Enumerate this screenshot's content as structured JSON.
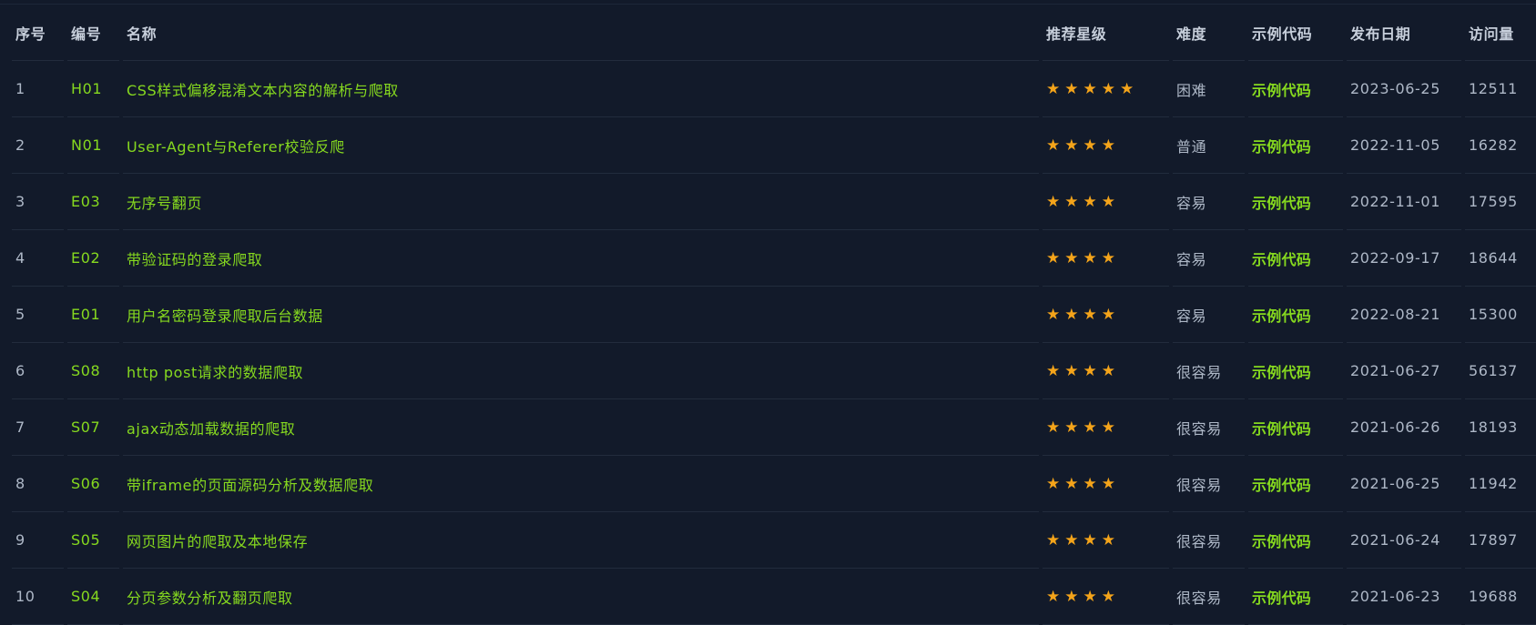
{
  "table": {
    "headers": {
      "index": "序号",
      "code": "编号",
      "name": "名称",
      "stars": "推荐星级",
      "difficulty": "难度",
      "example": "示例代码",
      "date": "发布日期",
      "views": "访问量"
    },
    "rows": [
      {
        "index": "1",
        "code": "H01",
        "name": "CSS样式偏移混淆文本内容的解析与爬取",
        "stars": "★★★★★",
        "star_count": 5,
        "difficulty": "困难",
        "example": "示例代码",
        "date": "2023-06-25",
        "views": "12511"
      },
      {
        "index": "2",
        "code": "N01",
        "name": "User-Agent与Referer校验反爬",
        "stars": "★★★★",
        "star_count": 4,
        "difficulty": "普通",
        "example": "示例代码",
        "date": "2022-11-05",
        "views": "16282"
      },
      {
        "index": "3",
        "code": "E03",
        "name": "无序号翻页",
        "stars": "★★★★",
        "star_count": 4,
        "difficulty": "容易",
        "example": "示例代码",
        "date": "2022-11-01",
        "views": "17595"
      },
      {
        "index": "4",
        "code": "E02",
        "name": "带验证码的登录爬取",
        "stars": "★★★★",
        "star_count": 4,
        "difficulty": "容易",
        "example": "示例代码",
        "date": "2022-09-17",
        "views": "18644"
      },
      {
        "index": "5",
        "code": "E01",
        "name": "用户名密码登录爬取后台数据",
        "stars": "★★★★",
        "star_count": 4,
        "difficulty": "容易",
        "example": "示例代码",
        "date": "2022-08-21",
        "views": "15300"
      },
      {
        "index": "6",
        "code": "S08",
        "name": "http post请求的数据爬取",
        "stars": "★★★★",
        "star_count": 4,
        "difficulty": "很容易",
        "example": "示例代码",
        "date": "2021-06-27",
        "views": "56137"
      },
      {
        "index": "7",
        "code": "S07",
        "name": "ajax动态加载数据的爬取",
        "stars": "★★★★",
        "star_count": 4,
        "difficulty": "很容易",
        "example": "示例代码",
        "date": "2021-06-26",
        "views": "18193"
      },
      {
        "index": "8",
        "code": "S06",
        "name": "带iframe的页面源码分析及数据爬取",
        "stars": "★★★★",
        "star_count": 4,
        "difficulty": "很容易",
        "example": "示例代码",
        "date": "2021-06-25",
        "views": "11942"
      },
      {
        "index": "9",
        "code": "S05",
        "name": "网页图片的爬取及本地保存",
        "stars": "★★★★",
        "star_count": 4,
        "difficulty": "很容易",
        "example": "示例代码",
        "date": "2021-06-24",
        "views": "17897"
      },
      {
        "index": "10",
        "code": "S04",
        "name": "分页参数分析及翻页爬取",
        "stars": "★★★★",
        "star_count": 4,
        "difficulty": "很容易",
        "example": "示例代码",
        "date": "2021-06-23",
        "views": "19688"
      }
    ]
  },
  "colors": {
    "background": "#121a2a",
    "link_green": "#86d91f",
    "star_orange": "#f4a41a",
    "text_gray": "#aeb8c7"
  }
}
